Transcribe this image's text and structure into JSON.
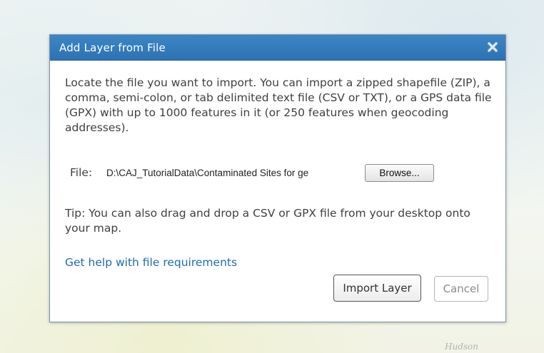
{
  "dialog": {
    "title": "Add Layer from File",
    "close_icon": "close-x-icon",
    "description": "Locate the file you want to import. You can import a zipped shapefile (ZIP), a comma, semi-colon, or tab delimited text file (CSV or TXT), or a GPS data file (GPX) with up to 1000 features in it (or 250 features when geocoding addresses).",
    "file_label": "File:",
    "file_value": "D:\\CAJ_TutorialData\\Contaminated Sites for ge",
    "browse_label": "Browse...",
    "tip": "Tip: You can also drag and drop a CSV or GPX file from your desktop onto your map.",
    "help_link": "Get help with file requirements",
    "import_label": "Import Layer",
    "cancel_label": "Cancel"
  },
  "map": {
    "label": "Hudson"
  },
  "colors": {
    "titlebar": "#2f76b7",
    "link": "#1f6bb1",
    "text": "#404040"
  }
}
